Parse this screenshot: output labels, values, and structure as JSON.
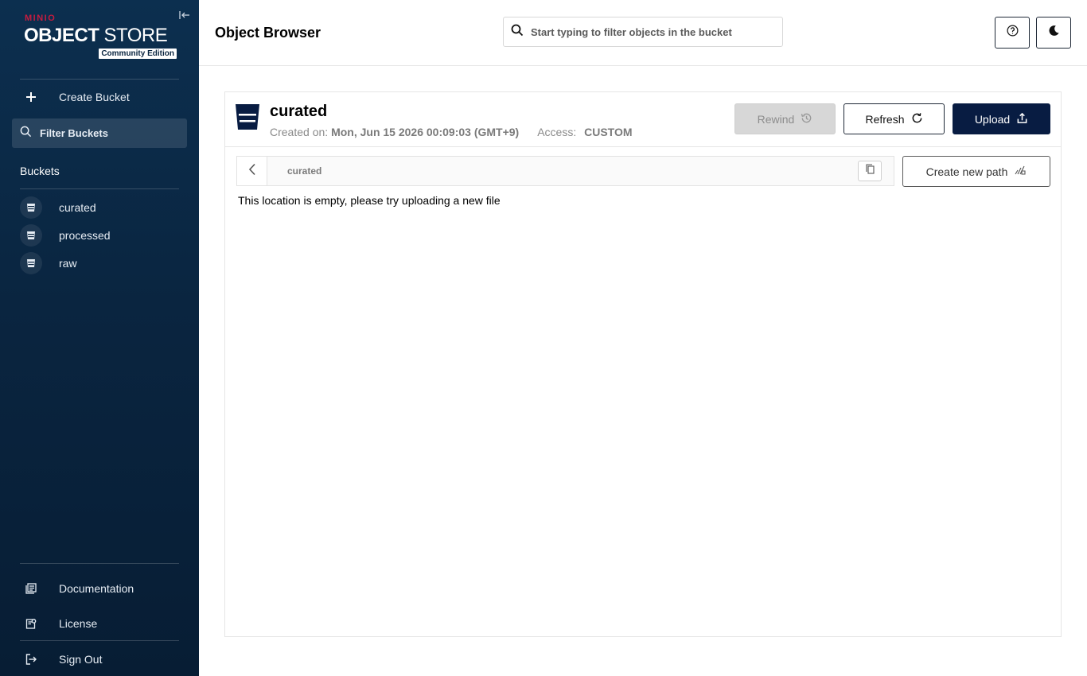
{
  "sidebar": {
    "logo": {
      "brand": "MINIO",
      "title_bold": "OBJECT",
      "title_rest": " STORE",
      "edition": "Community Edition"
    },
    "create_bucket": "Create Bucket",
    "filter_buckets": "Filter Buckets",
    "buckets_heading": "Buckets",
    "buckets": [
      {
        "label": "curated"
      },
      {
        "label": "processed"
      },
      {
        "label": "raw"
      }
    ],
    "footer": {
      "documentation": "Documentation",
      "license": "License",
      "sign_out": "Sign Out"
    }
  },
  "header": {
    "title": "Object Browser",
    "search_placeholder": "Start typing to filter objects in the bucket"
  },
  "bucket": {
    "name": "curated",
    "created_label": "Created on:",
    "created_value": "Mon, Jun 15 2026 00:09:03 (GMT+9)",
    "access_label": "Access:",
    "access_value": "CUSTOM"
  },
  "actions": {
    "rewind": "Rewind",
    "refresh": "Refresh",
    "upload": "Upload",
    "create_new_path": "Create new path"
  },
  "breadcrumb": {
    "path": "curated"
  },
  "empty_message": "This location is empty, please try uploading a new file",
  "colors": {
    "sidebar": "#0a2540",
    "accent": "#081c42",
    "brand_red": "#c51c3f"
  }
}
